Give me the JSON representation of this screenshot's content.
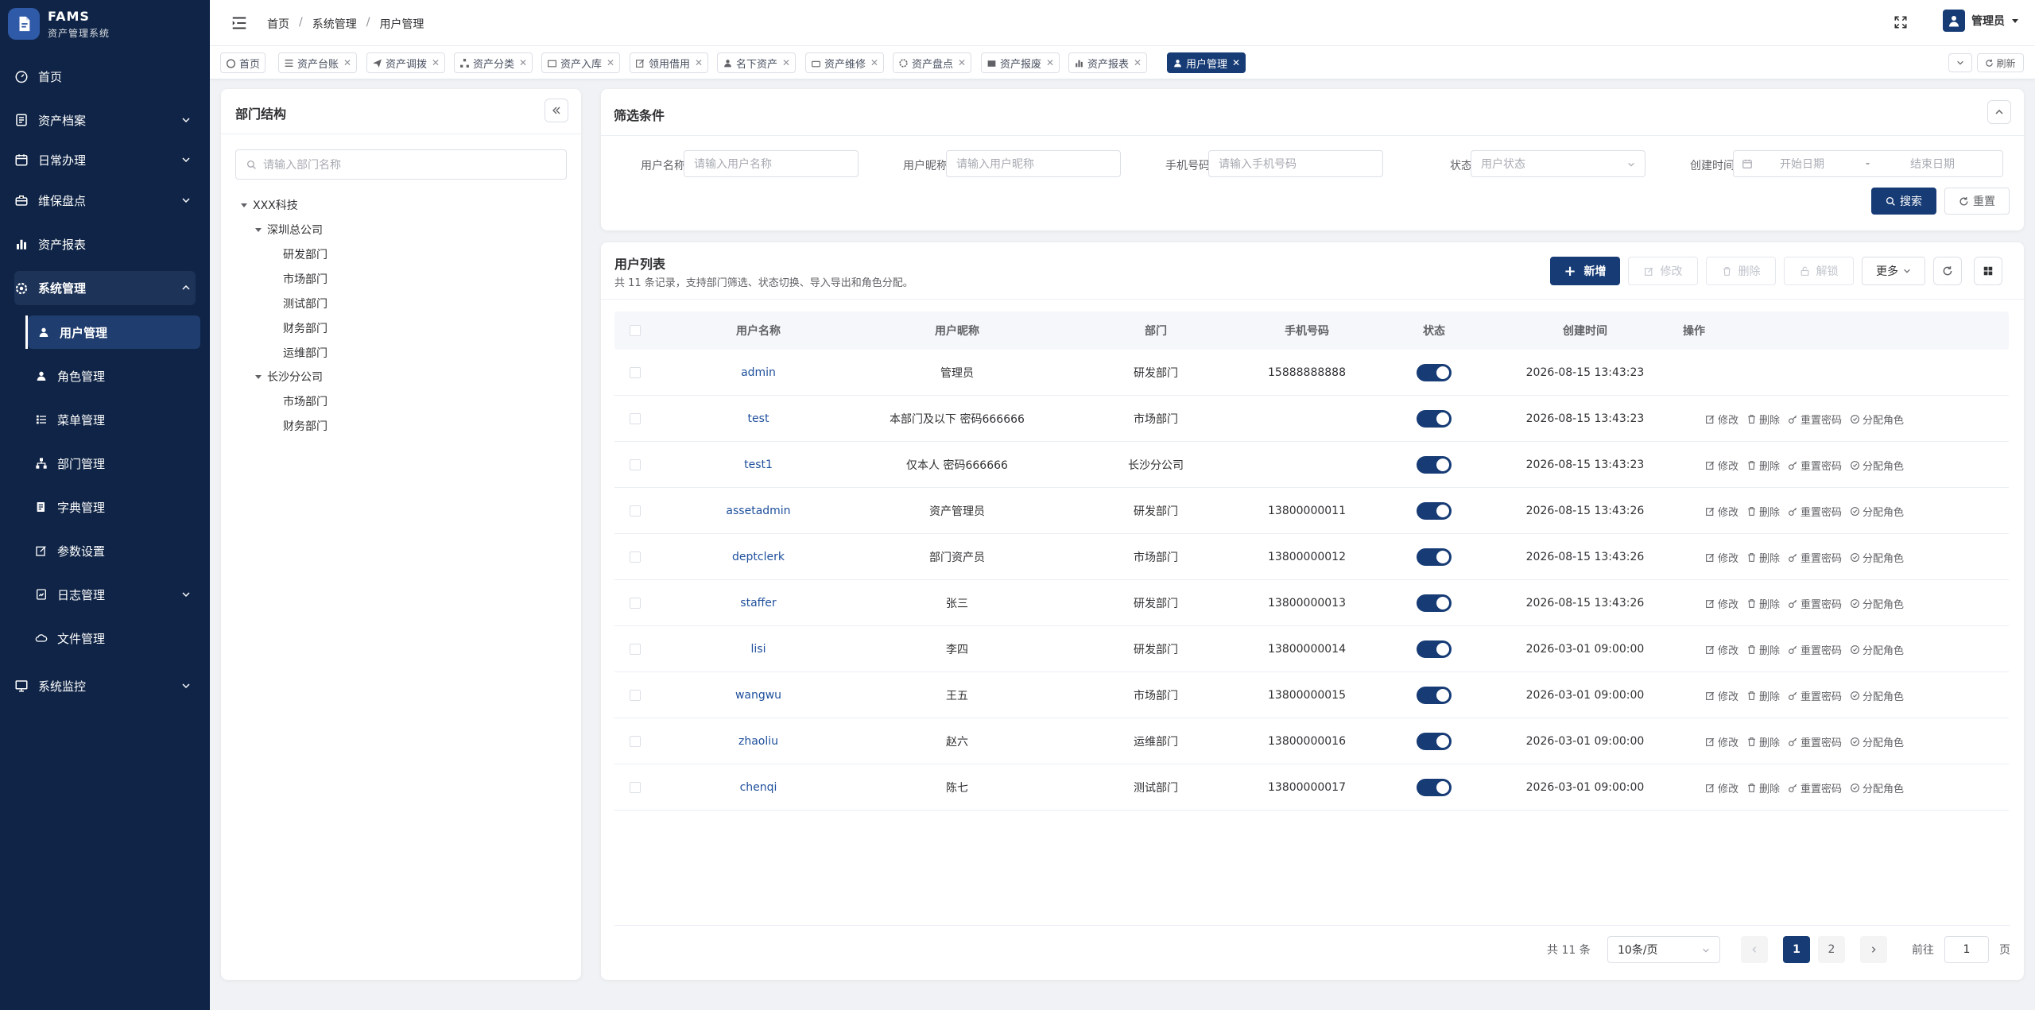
{
  "app": {
    "name": "FAMS",
    "subtitle": "资产管理系统"
  },
  "colors": {
    "sidebar_bg": "#0f2446",
    "primary": "#163b75",
    "link": "#1e4f9c"
  },
  "sidebar": {
    "items": [
      {
        "label": "首页",
        "icon": "dashboard-icon"
      },
      {
        "label": "资产档案",
        "icon": "archive-icon"
      },
      {
        "label": "日常办理",
        "icon": "calendar-icon"
      },
      {
        "label": "维保盘点",
        "icon": "toolbox-icon"
      },
      {
        "label": "资产报表",
        "icon": "bar-chart-icon"
      },
      {
        "label": "系统管理",
        "icon": "gear-icon"
      },
      {
        "label": "系统监控",
        "icon": "monitor-icon"
      }
    ],
    "sub_items": [
      {
        "label": "用户管理",
        "icon": "user-icon"
      },
      {
        "label": "角色管理",
        "icon": "role-icon"
      },
      {
        "label": "菜单管理",
        "icon": "menu-list-icon"
      },
      {
        "label": "部门管理",
        "icon": "org-icon"
      },
      {
        "label": "字典管理",
        "icon": "dict-icon"
      },
      {
        "label": "参数设置",
        "icon": "edit-icon"
      },
      {
        "label": "日志管理",
        "icon": "log-icon"
      },
      {
        "label": "文件管理",
        "icon": "cloud-icon"
      }
    ]
  },
  "header": {
    "breadcrumb": [
      "首页",
      "系统管理",
      "用户管理"
    ],
    "breadcrumb_sep": "/",
    "user": "管理员"
  },
  "tabs": {
    "items": [
      "首页",
      "资产台账",
      "资产调拨",
      "资产分类",
      "资产入库",
      "领用借用",
      "名下资产",
      "资产维修",
      "资产盘点",
      "资产报废",
      "资产报表",
      "用户管理"
    ],
    "active": "用户管理",
    "refresh_label": "刷新"
  },
  "dept_panel": {
    "title": "部门结构",
    "search_placeholder": "请输入部门名称",
    "tree": {
      "root": "XXX科技",
      "shenzhen": "深圳总公司",
      "shenzhen_children": [
        "研发部门",
        "市场部门",
        "测试部门",
        "财务部门",
        "运维部门"
      ],
      "changsha": "长沙分公司",
      "changsha_children": [
        "市场部门",
        "财务部门"
      ]
    }
  },
  "filter": {
    "title": "筛选条件",
    "username_label": "用户名称",
    "username_placeholder": "请输入用户名称",
    "nickname_label": "用户昵称",
    "nickname_placeholder": "请输入用户昵称",
    "phone_label": "手机号码",
    "phone_placeholder": "请输入手机号码",
    "status_label": "状态",
    "status_placeholder": "用户状态",
    "created_label": "创建时间",
    "start_placeholder": "开始日期",
    "date_sep": "-",
    "end_placeholder": "结束日期",
    "search_btn": "搜索",
    "reset_btn": "重置"
  },
  "user_list": {
    "title": "用户列表",
    "subtitle": "共 11 条记录，支持部门筛选、状态切换、导入导出和角色分配。",
    "toolbar": {
      "add": "新增",
      "edit": "修改",
      "delete": "删除",
      "unlock": "解锁",
      "more": "更多"
    },
    "columns": [
      "用户名称",
      "用户昵称",
      "部门",
      "手机号码",
      "状态",
      "创建时间",
      "操作"
    ],
    "ops": [
      "修改",
      "删除",
      "重置密码",
      "分配角色"
    ],
    "rows": [
      {
        "username": "admin",
        "nickname": "管理员",
        "dept": "研发部门",
        "phone": "15888888888",
        "enabled": true,
        "created": "2026-08-15 13:43:23",
        "ops": false
      },
      {
        "username": "test",
        "nickname": "本部门及以下 密码666666",
        "dept": "市场部门",
        "phone": "",
        "enabled": true,
        "created": "2026-08-15 13:43:23",
        "ops": true
      },
      {
        "username": "test1",
        "nickname": "仅本人 密码666666",
        "dept": "长沙分公司",
        "phone": "",
        "enabled": true,
        "created": "2026-08-15 13:43:23",
        "ops": true
      },
      {
        "username": "assetadmin",
        "nickname": "资产管理员",
        "dept": "研发部门",
        "phone": "13800000011",
        "enabled": true,
        "created": "2026-08-15 13:43:26",
        "ops": true
      },
      {
        "username": "deptclerk",
        "nickname": "部门资产员",
        "dept": "市场部门",
        "phone": "13800000012",
        "enabled": true,
        "created": "2026-08-15 13:43:26",
        "ops": true
      },
      {
        "username": "staffer",
        "nickname": "张三",
        "dept": "研发部门",
        "phone": "13800000013",
        "enabled": true,
        "created": "2026-08-15 13:43:26",
        "ops": true
      },
      {
        "username": "lisi",
        "nickname": "李四",
        "dept": "研发部门",
        "phone": "13800000014",
        "enabled": true,
        "created": "2026-03-01 09:00:00",
        "ops": true
      },
      {
        "username": "wangwu",
        "nickname": "王五",
        "dept": "市场部门",
        "phone": "13800000015",
        "enabled": true,
        "created": "2026-03-01 09:00:00",
        "ops": true
      },
      {
        "username": "zhaoliu",
        "nickname": "赵六",
        "dept": "运维部门",
        "phone": "13800000016",
        "enabled": true,
        "created": "2026-03-01 09:00:00",
        "ops": true
      },
      {
        "username": "chenqi",
        "nickname": "陈七",
        "dept": "测试部门",
        "phone": "13800000017",
        "enabled": true,
        "created": "2026-03-01 09:00:00",
        "ops": true
      }
    ]
  },
  "pagination": {
    "total": "共 11 条",
    "page_size": "10条/页",
    "pages": [
      "1",
      "2"
    ],
    "current": "1",
    "goto_label": "前往",
    "goto_value": "1",
    "page_suffix": "页"
  }
}
